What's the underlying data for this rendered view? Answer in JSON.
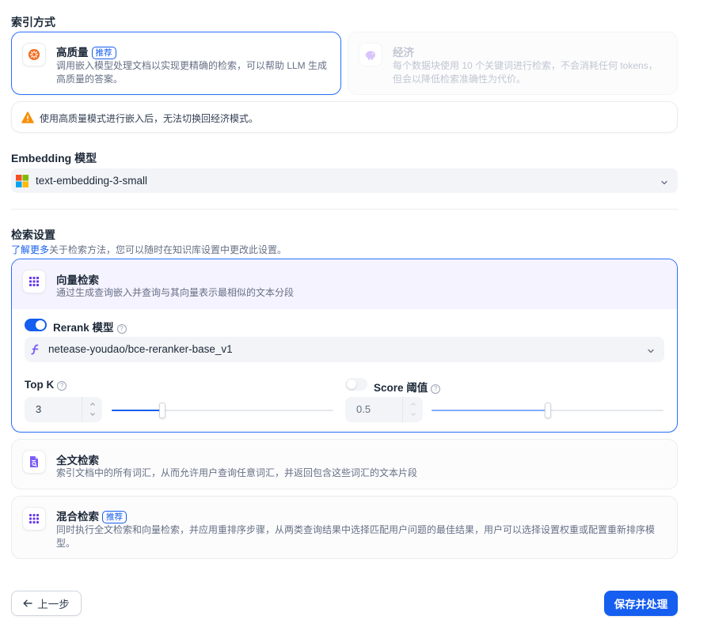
{
  "index_method": {
    "title": "索引方式",
    "high_quality": {
      "title": "高质量",
      "badge": "推荐",
      "desc": "调用嵌入模型处理文档以实现更精确的检索，可以帮助 LLM 生成高质量的答案。"
    },
    "economy": {
      "title": "经济",
      "desc": "每个数据块使用 10 个关键词进行检索，不会消耗任何 tokens，但会以降低检索准确性为代价。"
    },
    "warning": "使用高质量模式进行嵌入后，无法切换回经济模式。"
  },
  "embedding": {
    "title": "Embedding 模型",
    "model": "text-embedding-3-small"
  },
  "retrieval": {
    "title": "检索设置",
    "learn_more": "了解更多",
    "hint": "关于检索方法，您可以随时在知识库设置中更改此设置。",
    "vector": {
      "title": "向量检索",
      "desc": "通过生成查询嵌入并查询与其向量表示最相似的文本分段"
    },
    "rerank": {
      "label": "Rerank 模型",
      "enabled": true,
      "model": "netease-youdao/bce-reranker-base_v1"
    },
    "top_k": {
      "label": "Top K",
      "value": "3",
      "slider_fraction": 0.23
    },
    "score": {
      "label": "Score 阈值",
      "enabled": false,
      "value": "0.5",
      "slider_fraction": 0.5
    },
    "fulltext": {
      "title": "全文检索",
      "desc": "索引文档中的所有词汇，从而允许用户查询任意词汇，并返回包含这些词汇的文本片段"
    },
    "hybrid": {
      "title": "混合检索",
      "badge": "推荐",
      "desc": "同时执行全文检索和向量检索，并应用重排序步骤，从两类查询结果中选择匹配用户问题的最佳结果，用户可以选择设置权重或配置重新排序模型。"
    }
  },
  "actions": {
    "back": "上一步",
    "save": "保存并处理"
  },
  "colors": {
    "primary": "#155eef",
    "selected_border": "#2970ff",
    "warning": "#f79009"
  }
}
